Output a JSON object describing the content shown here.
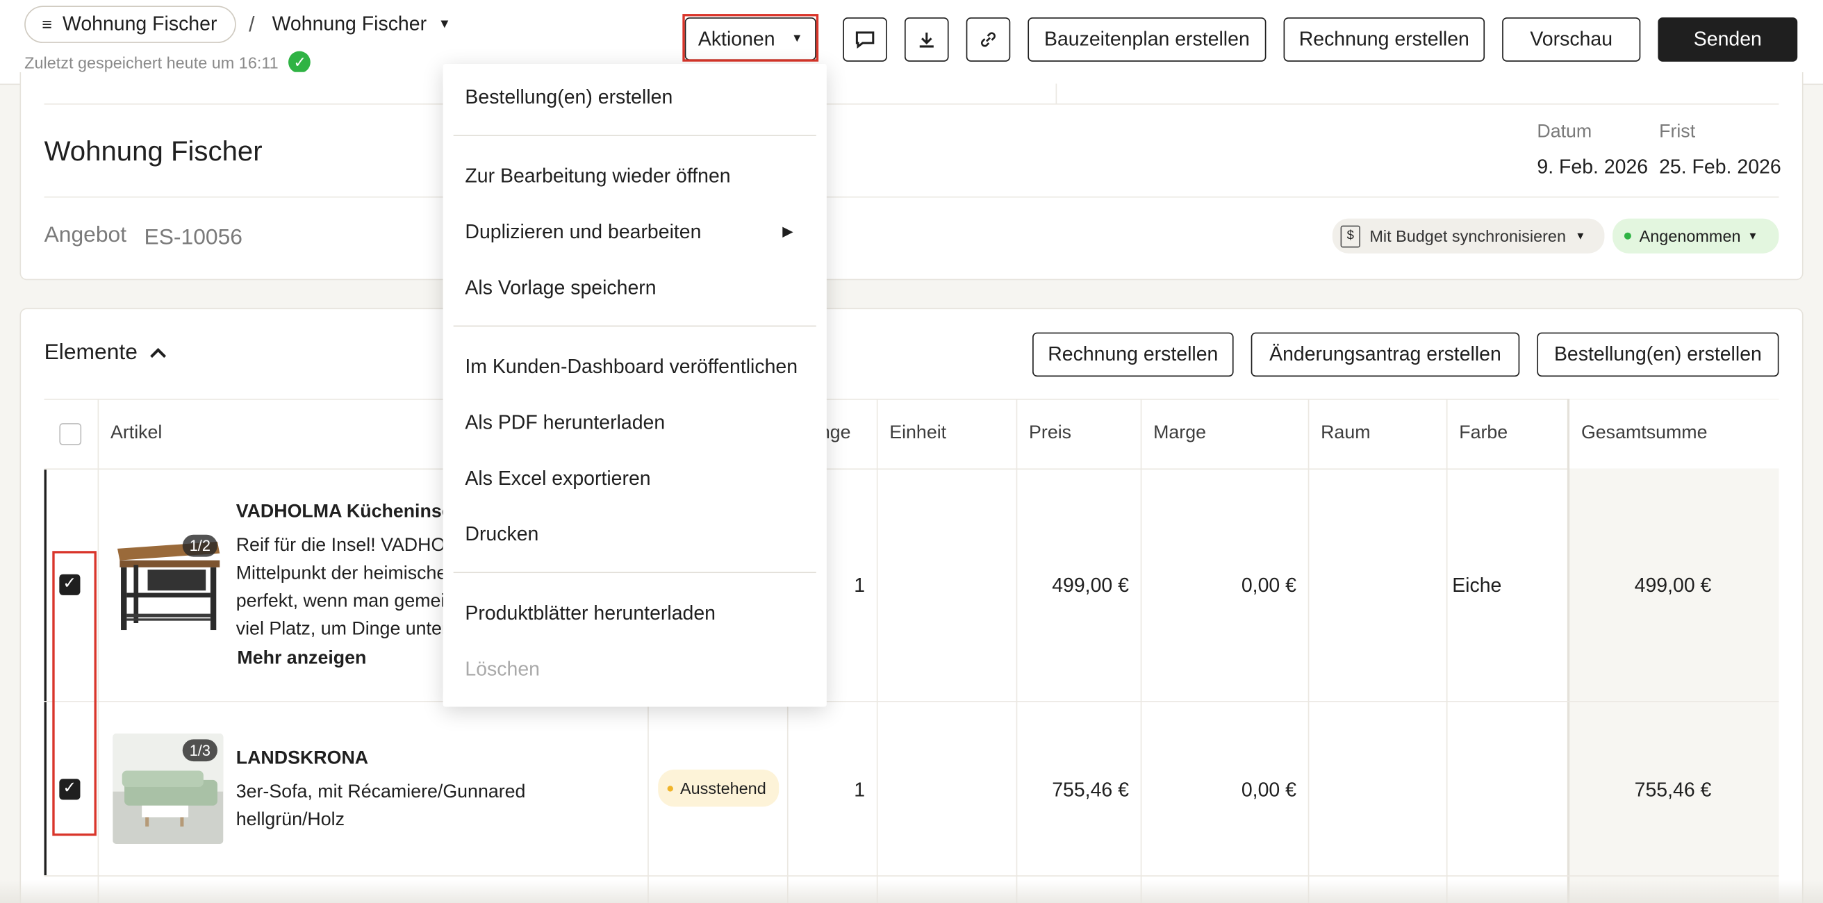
{
  "header": {
    "menu_label": "Wohnung Fischer",
    "breadcrumb_sep": "/",
    "project_name": "Wohnung Fischer",
    "saved_text": "Zuletzt gespeichert heute um 16:11",
    "actions_label": "Aktionen",
    "schedule_label": "Bauzeitenplan erstellen",
    "invoice_label": "Rechnung erstellen",
    "preview_label": "Vorschau",
    "send_label": "Senden"
  },
  "document": {
    "title": "Wohnung Fischer",
    "type_label": "Angebot",
    "number": "ES-10056",
    "date_label": "Datum",
    "date_value": "9. Feb. 2026",
    "due_label": "Frist",
    "due_value": "25. Feb. 2026",
    "budget_sync_label": "Mit Budget synchronisieren",
    "status_label": "Angenommen"
  },
  "elements": {
    "heading": "Elemente",
    "invoice_button": "Rechnung erstellen",
    "change_request_button": "Änderungsantrag erstellen",
    "orders_button": "Bestellung(en) erstellen",
    "columns": {
      "artikel": "Artikel",
      "menge": "nge",
      "einheit": "Einheit",
      "preis": "Preis",
      "marge": "Marge",
      "raum": "Raum",
      "farbe": "Farbe",
      "gesamt": "Gesamtsumme"
    },
    "rows": [
      {
        "title": "VADHOLMA Kücheninsel",
        "image_counter": "1/2",
        "desc1": "Reif für die Insel! VADHOLMA",
        "desc2": "Mittelpunkt der heimischen",
        "desc3": "perfekt, wenn man gemeinsam",
        "desc4": "viel Platz, um Dinge unterzubringen",
        "more_label": "Mehr anzeigen",
        "quantity": "1",
        "price": "499,00 €",
        "margin": "0,00 €",
        "color": "Eiche",
        "total": "499,00 €"
      },
      {
        "title": "LANDSKRONA",
        "image_counter": "1/3",
        "desc1": "3er-Sofa, mit Récamiere/Gunnared",
        "desc2": "hellgrün/Holz",
        "status": "Ausstehend",
        "quantity": "1",
        "price": "755,46 €",
        "margin": "0,00 €",
        "total": "755,46 €"
      }
    ]
  },
  "actions_menu": {
    "items": [
      "Bestellung(en) erstellen",
      "Zur Bearbeitung wieder öffnen",
      "Duplizieren und bearbeiten",
      "Als Vorlage speichern",
      "Im Kunden-Dashboard veröffentlichen",
      "Als PDF herunterladen",
      "Als Excel exportieren",
      "Drucken",
      "Produktblätter herunterladen",
      "Löschen"
    ]
  },
  "colors": {
    "accent_dark": "#1f1f1f",
    "success_green": "#2fb344",
    "highlight_red": "#d9352a",
    "status_pending_bg": "#fdf3d8",
    "status_accepted_bg": "#e3f6df"
  }
}
